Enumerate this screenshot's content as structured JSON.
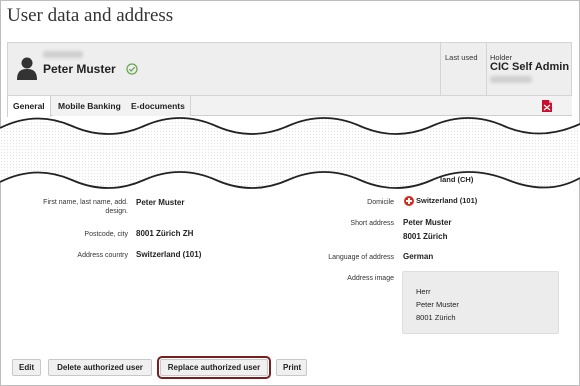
{
  "page": {
    "title": "User data and address"
  },
  "header": {
    "user_name": "Peter Muster",
    "last_used_label": "Last used",
    "holder_label": "Holder",
    "holder_value": "CIC Self Admin"
  },
  "tabs": [
    {
      "label": "General",
      "active": true
    },
    {
      "label": "Mobile Banking",
      "active": false
    },
    {
      "label": "E-documents",
      "active": false
    }
  ],
  "form": {
    "domicile_top": "land (CH)",
    "left": {
      "name_label": "First name, last name, add. design.",
      "name_value": "Peter Muster",
      "postcode_label": "Postcode, city",
      "postcode_value": "8001 Zürich ZH",
      "country_label": "Address country",
      "country_value": "Switzerland (101)"
    },
    "right": {
      "domicile_label": "Domicile",
      "domicile_value": "Switzerland (101)",
      "short_address_label": "Short address",
      "short_address_line1": "Peter Muster",
      "short_address_line2": "8001 Zürich",
      "language_label": "Language of address",
      "language_value": "German",
      "address_image_label": "Address image",
      "address_image_lines": [
        "Herr",
        "Peter Muster",
        "8001 Zürich"
      ]
    }
  },
  "buttons": {
    "edit": "Edit",
    "delete": "Delete authorized user",
    "replace": "Replace authorized user",
    "print": "Print"
  },
  "colors": {
    "verified": "#6aa84f",
    "swiss_red": "#d52b1e",
    "pdf_red": "#c8102e",
    "highlight": "#7a1e1e"
  }
}
